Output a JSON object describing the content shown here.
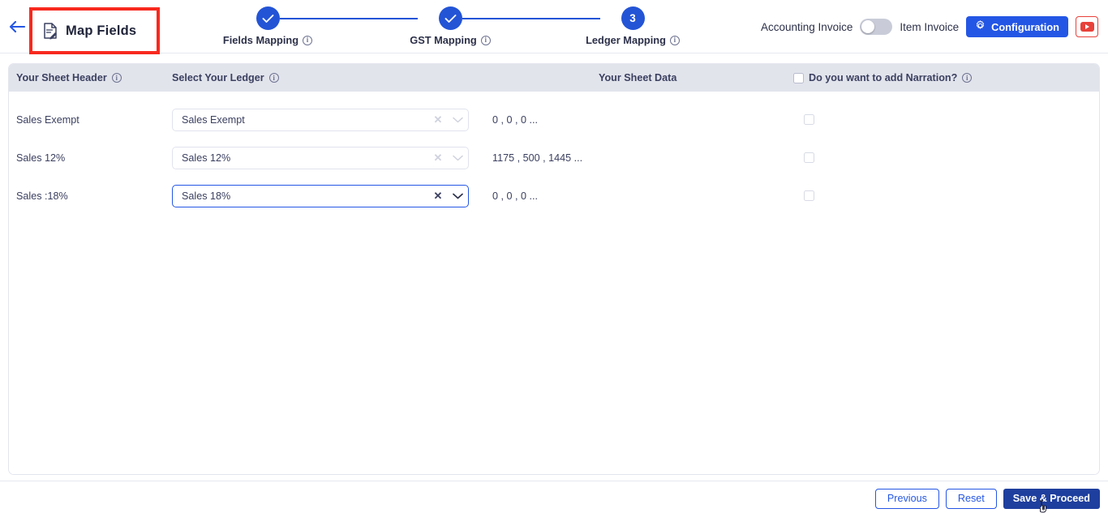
{
  "header": {
    "back_icon": "back-arrow-icon",
    "doc_icon": "document-edit-icon",
    "title": "Map Fields"
  },
  "stepper": {
    "steps": [
      {
        "label": "Fields Mapping",
        "marker": "✓",
        "state": "completed",
        "info_icon": "info-icon"
      },
      {
        "label": "GST Mapping",
        "marker": "✓",
        "state": "completed",
        "info_icon": "info-icon"
      },
      {
        "label": "Ledger Mapping",
        "marker": "3",
        "state": "active",
        "info_icon": "info-icon"
      }
    ]
  },
  "toolbar": {
    "accounting_invoice_label": "Accounting Invoice",
    "item_invoice_label": "Item Invoice",
    "toggle_state": "off",
    "configuration_label": "Configuration",
    "gear_icon": "gear-icon",
    "youtube_icon": "youtube-icon"
  },
  "table": {
    "columns": {
      "sheet_header": "Your Sheet Header",
      "select_ledger": "Select Your Ledger",
      "sheet_data": "Your Sheet Data",
      "narration": "Do you want to add Narration?"
    },
    "rows": [
      {
        "sheet_header": "Sales Exempt",
        "ledger_value": "Sales Exempt",
        "sheet_data": "0 , 0 , 0 ...",
        "narration_checked": false,
        "focused": false,
        "clear_icon": "clear-x-icon",
        "chevron_icon": "chevron-down-icon"
      },
      {
        "sheet_header": "Sales 12%",
        "ledger_value": "Sales 12%",
        "sheet_data": "1175 , 500 , 1445 ...",
        "narration_checked": false,
        "focused": false,
        "clear_icon": "clear-x-icon",
        "chevron_icon": "chevron-down-icon"
      },
      {
        "sheet_header": "Sales :18%",
        "ledger_value": "Sales 18%",
        "sheet_data": "0 , 0 , 0 ...",
        "narration_checked": false,
        "focused": true,
        "clear_icon": "clear-x-icon",
        "chevron_icon": "chevron-down-icon"
      }
    ]
  },
  "footer": {
    "previous_label": "Previous",
    "reset_label": "Reset",
    "save_label": "Save & Proceed"
  },
  "colors": {
    "accent_blue": "#2456e5",
    "step_blue": "#2354d6",
    "primary_dark": "#1f3f9e",
    "annotation_red": "#f8291e",
    "youtube_red": "#e8413a",
    "header_grey": "#e2e4ec",
    "text_dark": "#3b4060"
  }
}
